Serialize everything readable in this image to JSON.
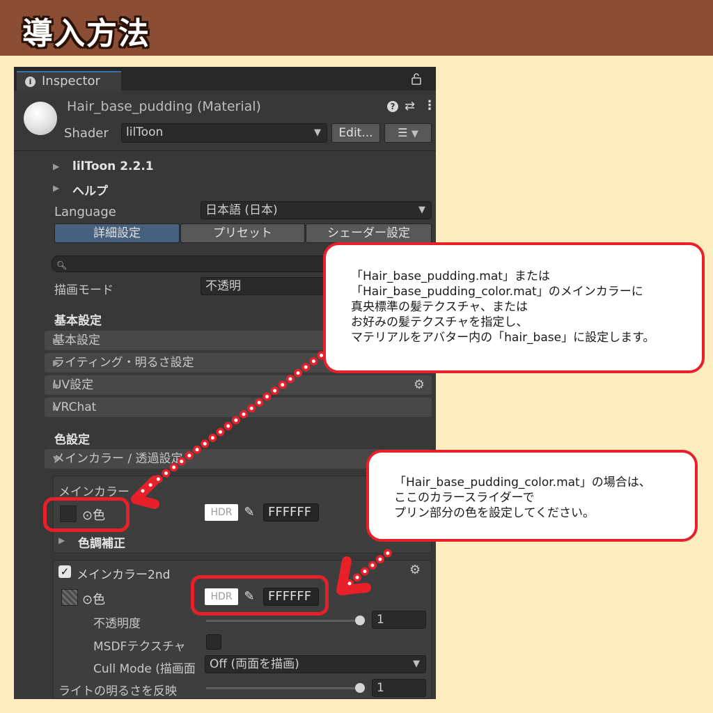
{
  "banner": {
    "title": "導入方法"
  },
  "inspector": {
    "tab_label": "Inspector",
    "tab_icon": "info-icon",
    "lock_icon": "lock-icon",
    "material_name": "Hair_base_pudding (Material)",
    "shader_label": "Shader",
    "shader_value": "lilToon",
    "edit_button": "Edit...",
    "version_label": "lilToon 2.2.1",
    "help_label": "ヘルプ",
    "language_label": "Language",
    "language_value": "日本語 (日本)",
    "tabs": [
      "詳細設定",
      "プリセット",
      "シェーダー設定"
    ],
    "search_placeholder": "",
    "render_mode_label": "描画モード",
    "render_mode_value": "不透明",
    "basic_section": "基本設定",
    "folds": [
      "基本設定",
      "ライティング・明るさ設定",
      "UV設定",
      "VRChat"
    ],
    "color_section": "色設定",
    "main_color_fold": "メインカラー / 透過設定",
    "main_color_header": "メインカラー",
    "color_label": "⊙色",
    "hdr_label": "HDR",
    "hex_value": "FFFFFF",
    "tone_correction": "色調補正",
    "main_color_2nd": "メインカラー2nd",
    "color2_label": "⊙色",
    "hex2_value": "FFFFFF",
    "opacity_label": "不透明度",
    "opacity_value": "1",
    "msdf_label": "MSDFテクスチャ",
    "cull_label": "Cull Mode (描画面",
    "cull_value": "Off (両面を描画)",
    "light_label": "ライトの明るさを反映",
    "light_value": "1"
  },
  "callouts": {
    "top": {
      "line1": "「Hair_base_pudding.mat」または",
      "line2": "「Hair_base_pudding_color.mat」のメインカラーに",
      "line3": "真央標準の髪テクスチャ、または",
      "line4": "お好みの髪テクスチャを指定し、",
      "line5": "マテリアルをアバター内の「hair_base」に設定します。"
    },
    "bottom": {
      "line1": "「Hair_base_pudding_color.mat」の場合は、",
      "line2": "ここのカラースライダーで",
      "line3": "プリン部分の色を設定してください。"
    }
  },
  "colors": {
    "banner": "#8b4e34",
    "background": "#fdecbf",
    "accent_red": "#e8202a",
    "tab_active": "#46607e"
  }
}
